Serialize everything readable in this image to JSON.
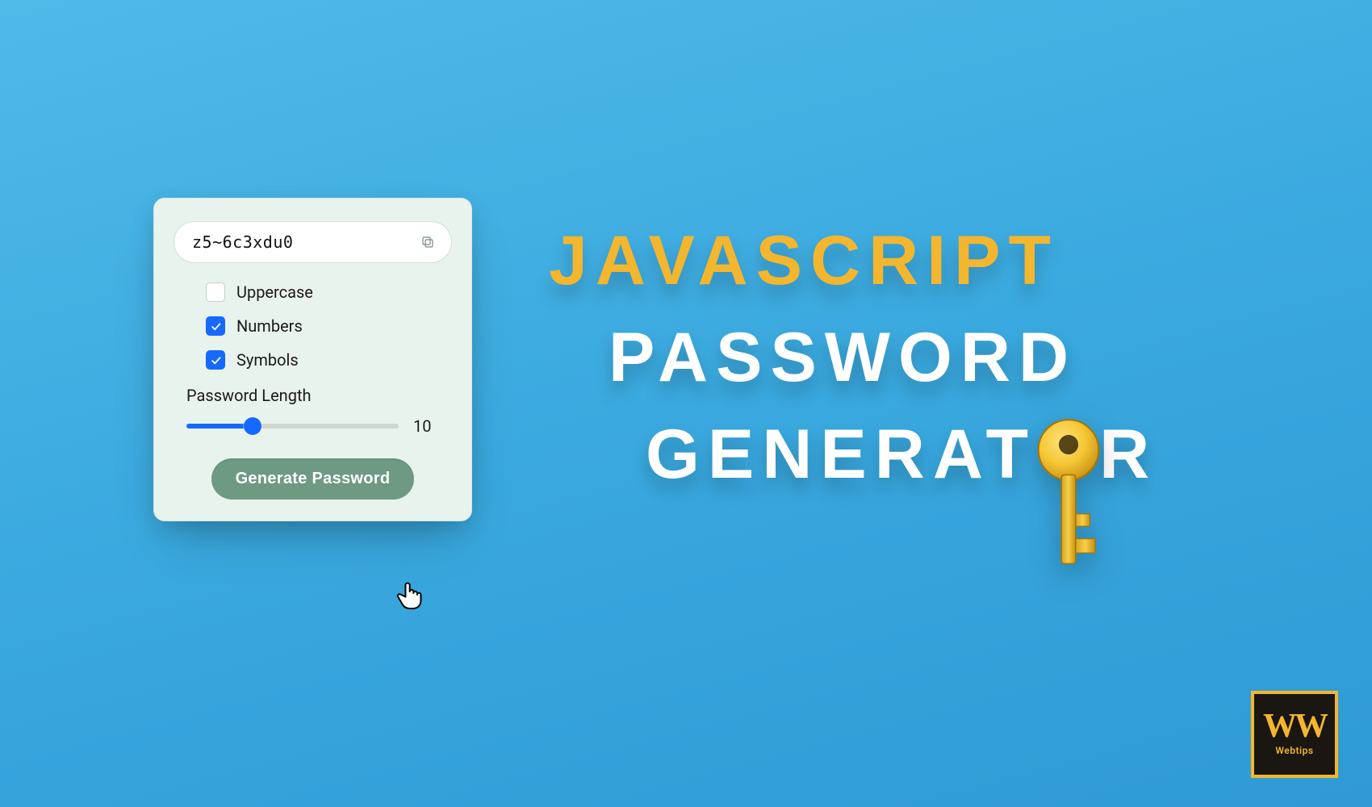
{
  "card": {
    "password_value": "z5~6c3xdu0",
    "options": [
      {
        "label": "Uppercase",
        "checked": false
      },
      {
        "label": "Numbers",
        "checked": true
      },
      {
        "label": "Symbols",
        "checked": true
      }
    ],
    "slider": {
      "label": "Password Length",
      "value": 10,
      "min": 1,
      "max": 30,
      "fill_percent": 31
    },
    "button_label": "Generate Password"
  },
  "headline": {
    "line1": "JAVASCRIPT",
    "line2": "PASSWORD",
    "line3_pre": "GENERAT",
    "line3_post": "R"
  },
  "logo": {
    "mark": "WW",
    "text": "Webtips"
  },
  "colors": {
    "accent_yellow": "#f3b62e",
    "accent_blue": "#1569ff",
    "button_green": "#6e9983",
    "card_bg": "#e9f3ee"
  }
}
